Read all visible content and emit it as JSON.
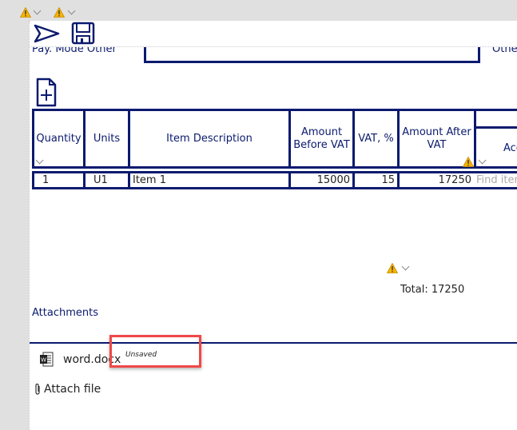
{
  "form": {
    "pay_mode_label": "Pay. Mode Other",
    "other_label": "Othe",
    "pay_mode_value": ""
  },
  "table": {
    "headers": [
      "Quantity",
      "Units",
      "Item Description",
      "Amount Before VAT",
      "VAT, %",
      "Amount After VAT",
      "Acc"
    ],
    "rows": [
      {
        "quantity": "1",
        "units": "U1",
        "description": "Item 1",
        "amount_before_vat": "15000",
        "vat_percent": "15",
        "amount_after_vat": "17250",
        "account_placeholder": "Find item"
      }
    ]
  },
  "total": "Total: 17250",
  "attachments": {
    "title": "Attachments",
    "files": [
      {
        "name": "word.docx",
        "status": "Unsaved"
      }
    ],
    "attach_label": "Attach file"
  },
  "colors": {
    "navy": "#0b1a6e",
    "warning": "#f5b400",
    "highlight": "#f04848"
  }
}
